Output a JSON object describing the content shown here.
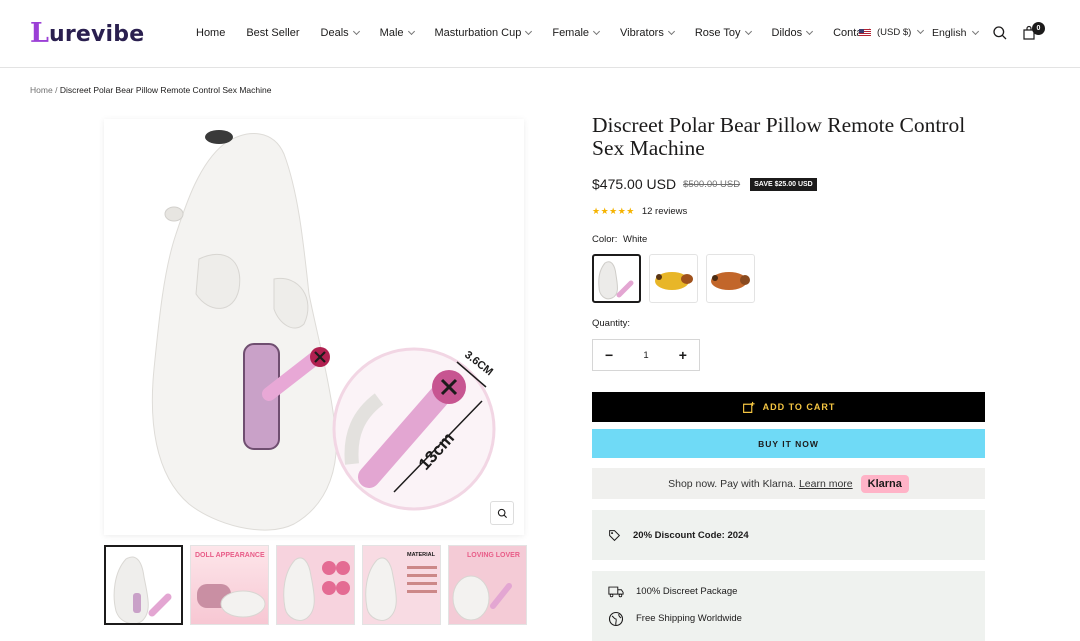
{
  "header": {
    "logo_initial": "L",
    "logo_text": "urevibe",
    "nav": [
      {
        "label": "Home",
        "dropdown": false
      },
      {
        "label": "Best Seller",
        "dropdown": false
      },
      {
        "label": "Deals",
        "dropdown": true
      },
      {
        "label": "Male",
        "dropdown": true
      },
      {
        "label": "Masturbation Cup",
        "dropdown": true
      },
      {
        "label": "Female",
        "dropdown": true
      },
      {
        "label": "Vibrators",
        "dropdown": true
      },
      {
        "label": "Rose Toy",
        "dropdown": true
      },
      {
        "label": "Dildos",
        "dropdown": true
      },
      {
        "label": "Contact",
        "dropdown": false
      }
    ],
    "currency": "(USD $)",
    "language": "English",
    "cart_count": "0"
  },
  "breadcrumb": {
    "home": "Home",
    "separator": "/",
    "current": "Discreet Polar Bear Pillow Remote Control Sex Machine"
  },
  "gallery": {
    "dimension_width": "3.6CM",
    "dimension_length": "13cm",
    "thumbnails": [
      {
        "label": ""
      },
      {
        "label": "DOLL APPEARANCE"
      },
      {
        "label": ""
      },
      {
        "label": "MATERIAL"
      },
      {
        "label": "LOVING LOVER"
      }
    ]
  },
  "product": {
    "title": "Discreet Polar Bear Pillow Remote Control Sex Machine",
    "price": "$475.00 USD",
    "compare_price": "$500.00 USD",
    "save_badge": "SAVE $25.00 USD",
    "stars": "★★★★★",
    "rating": 4.5,
    "reviews": "12 reviews",
    "color_label": "Color:",
    "color_value": "White",
    "swatches": [
      {
        "name": "White",
        "color": "#ecebe9"
      },
      {
        "name": "Yellow",
        "color": "#e8b628"
      },
      {
        "name": "Brown",
        "color": "#c2662a"
      }
    ],
    "quantity_label": "Quantity:",
    "quantity": "1",
    "minus": "−",
    "plus": "+",
    "add_to_cart": "ADD TO CART",
    "buy_now": "BUY IT NOW",
    "klarna_text": "Shop now. Pay with Klarna.",
    "klarna_link": "Learn more",
    "klarna_badge": "Klarna",
    "discount_code": "20% Discount Code: 2024",
    "features": [
      "100% Discreet Package",
      "Free Shipping Worldwide"
    ]
  },
  "colors": {
    "accent_buy": "#6fdaf6",
    "cart_bg": "#000000",
    "cart_text": "#f4c542",
    "logo": "#9b3fd6",
    "klarna": "#ffb3c7"
  }
}
